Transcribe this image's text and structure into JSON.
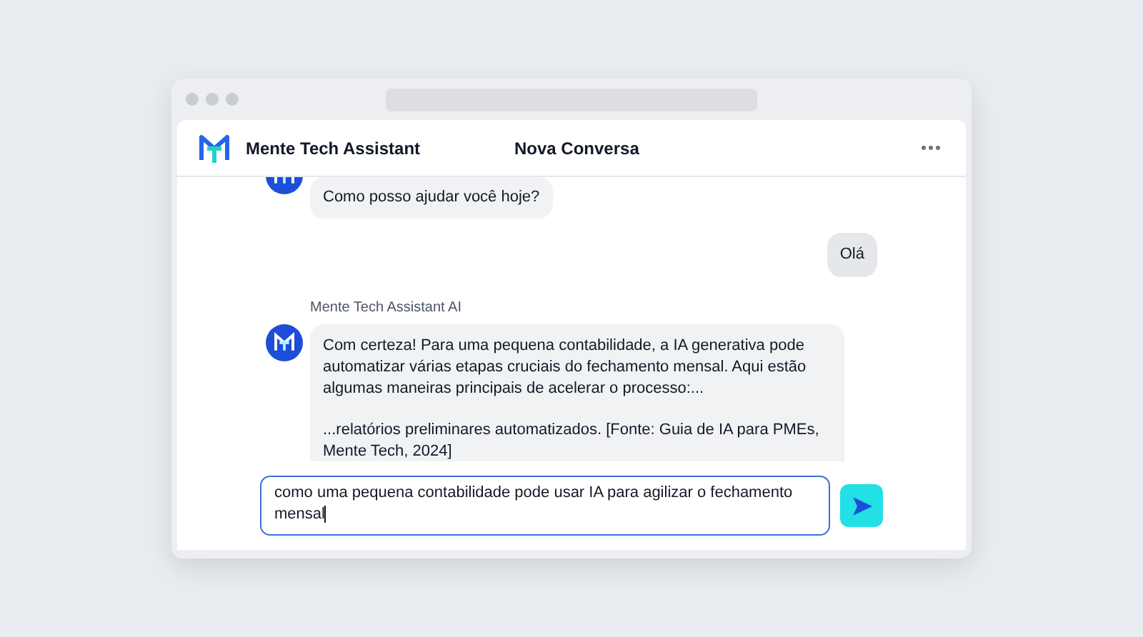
{
  "window": {
    "title": "Nova Conversa"
  },
  "app": {
    "name": "Mente Tech Assistant"
  },
  "messages": [
    {
      "kind": "assistant",
      "paragraphs": [
        "Como posso ajudar você hoje?"
      ]
    },
    {
      "kind": "user",
      "paragraphs": [
        "Olá"
      ]
    },
    {
      "kind": "assistant",
      "sender": "Mente Tech Assistant AI",
      "paragraphs": [
        "Com certeza! Para uma pequena contabilidade, a IA generativa pode automatizar várias etapas cruciais do fechamento mensal. Aqui estão algumas maneiras principais de acelerar o processo:...",
        "...relatórios preliminares automatizados. [Fonte: Guia de IA para PMEs, Mente Tech, 2024]"
      ]
    }
  ],
  "composer": {
    "value": "como uma pequena contabilidade pode usar IA para agilizar o fechamento mensal"
  }
}
